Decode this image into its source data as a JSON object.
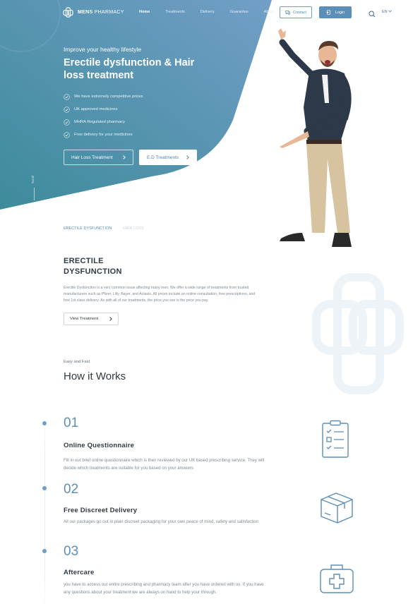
{
  "nav": {
    "logo_bold": "MENS",
    "logo_light": "PHARMACY",
    "links": [
      "Home",
      "Treatments",
      "Delivery",
      "Guarantee",
      "About"
    ],
    "contact_label": "Contact",
    "login_label": "Login",
    "language": "EN"
  },
  "hero": {
    "eyebrow": "Improve your healthy lifestyle",
    "title": "Erectile dysfunction & Hair loss treatment",
    "features": [
      "We have extremely competitive prices",
      "UK approved medicines",
      "MHRA Regulated pharmacy",
      "Free delivery for your medicines"
    ],
    "button_hair": "Hair Loss Treatment",
    "button_ed": "E.D Treatments",
    "scroll_label": "Scroll"
  },
  "treatments": {
    "tabs": [
      "ERECTILE DYSFUNCTION",
      "HAIR LOSS"
    ],
    "title_line1": "ERECTILE",
    "title_line2": "DYSFUNCTION",
    "description": "Erectile Dysfunction is a very common issue affecting many men. We offer a wide range of treatments from trusted manufacturers such as Pfizer, Lilly, Bayer, and Actavis. All prices include an online consultation, free prescriptions, and free 1st class delivery. As with all of our treatments, the price you see is the price you pay.",
    "button": "View Treatment"
  },
  "how": {
    "caption": "Easy and Fast",
    "title": "How it Works",
    "steps": [
      {
        "number": "01",
        "title": "Online Questionnaire",
        "desc": "Fill in our brief online questionnaire which is then reviewed by our UK based prescribing service. They will decide which treatments are suitable for you based on your answers"
      },
      {
        "number": "02",
        "title": "Free Discreet Delivery",
        "desc": "All our packages go out in plain discreet packaging for your own peace of mind, safety and satisfaction"
      },
      {
        "number": "03",
        "title": "Aftercare",
        "desc": "you have to access our entire prescribing and pharmacy team after you have ordered with us. If you have any questions about your treatment we are always on hand to help your through."
      }
    ]
  },
  "icons": {
    "logo": "logo-icon",
    "contact": "chat-icon",
    "login": "login-icon",
    "search": "search-icon",
    "check": "check-circle-icon",
    "step1": "clipboard-checklist-icon",
    "step2": "package-box-icon",
    "step3": "first-aid-kit-icon"
  },
  "colors": {
    "brand": "#5b8fb7",
    "hero_dark": "#3f8a9e",
    "hero_light": "#6a9bc4",
    "text_dark": "#2f3a44"
  }
}
